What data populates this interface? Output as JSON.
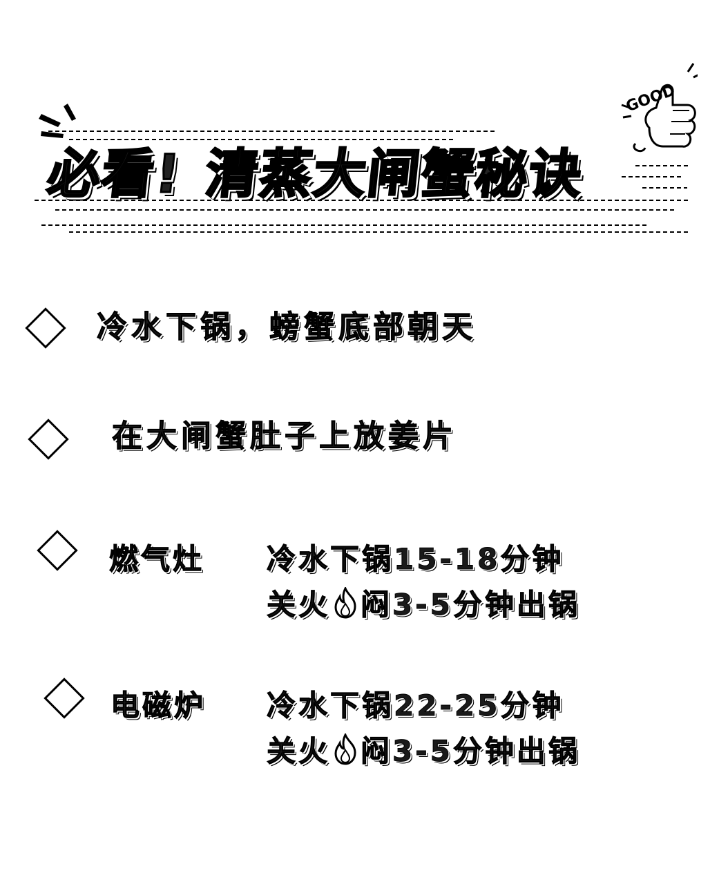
{
  "title": {
    "part1": "必看!",
    "part2": "清蒸大闸蟹秘诀",
    "sticker_text": "GOOD"
  },
  "tips": [
    {
      "text": "冷水下锅，螃蟹底部朝天"
    },
    {
      "text": "在大闸蟹肚子上放姜片"
    }
  ],
  "methods": [
    {
      "label": "燃气灶",
      "line1": "冷水下锅15-18分钟",
      "line2_before_icon": "关火",
      "line2_after_icon": "闷3-5分钟出锅"
    },
    {
      "label": "电磁炉",
      "line1": "冷水下锅22-25分钟",
      "line2_before_icon": "关火",
      "line2_after_icon": "闷3-5分钟出锅"
    }
  ],
  "icons": {
    "bullet": "diamond-icon",
    "fire": "fire-icon",
    "thumbs_up": "thumbs-up-icon"
  },
  "colors": {
    "background": "#ffffff",
    "ink": "#000000"
  }
}
